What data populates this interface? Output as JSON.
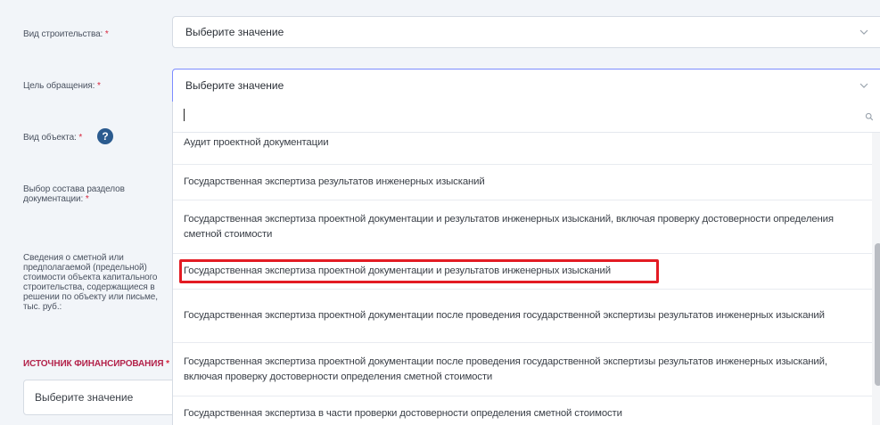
{
  "form": {
    "construction_type": {
      "label": "Вид строительства:",
      "required": "*",
      "placeholder": "Выберите значение"
    },
    "purpose": {
      "label": "Цель обращения:",
      "required": "*",
      "placeholder": "Выберите значение"
    },
    "object_type": {
      "label": "Вид объекта:",
      "required": "*",
      "help": "?"
    },
    "sections": {
      "label": "Выбор состава разделов документации:",
      "required": "*"
    },
    "cost_info": {
      "label": "Сведения о сметной или предполагаемой (предельной) стоимости объекта капитального строительства, содержащиеся в решении по объекту или письме, тыс. руб.:"
    },
    "funding": {
      "label": "ИСТОЧНИК ФИНАНСИРОВАНИЯ",
      "required": "*",
      "placeholder": "Выберите значение"
    }
  },
  "dropdown": {
    "search_value": "",
    "options": [
      {
        "label": "Аудит проектной документации"
      },
      {
        "label": "Государственная экспертиза результатов инженерных изысканий"
      },
      {
        "label": "Государственная экспертиза проектной документации и результатов инженерных изысканий, включая проверку достоверности определения сметной стоимости"
      },
      {
        "label": "Государственная экспертиза проектной документации и результатов инженерных изысканий",
        "highlighted": true
      },
      {
        "label": "Государственная экспертиза проектной документации после проведения государственной экспертизы результатов инженерных изысканий"
      },
      {
        "label": "Государственная экспертиза проектной документации после проведения государственной экспертизы результатов инженерных изысканий, включая проверку достоверности определения сметной стоимости"
      },
      {
        "label": "Государственная экспертиза в части проверки достоверности определения сметной стоимости"
      }
    ]
  },
  "colors": {
    "required": "#d7263d",
    "highlight": "#e31b23",
    "help_bg": "#2b5b8f",
    "funding_label": "#b3224a"
  },
  "icons": [
    "chevron-down-icon",
    "search-icon",
    "help-icon"
  ]
}
